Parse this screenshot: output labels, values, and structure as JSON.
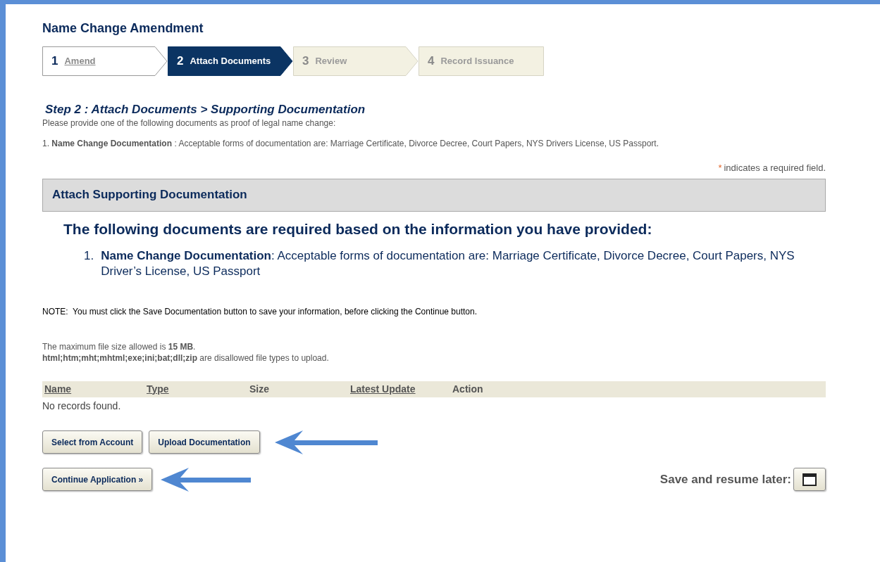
{
  "page_title": "Name Change Amendment",
  "steps": [
    {
      "number": "1",
      "label": "Amend",
      "selected": false,
      "completed": true
    },
    {
      "number": "2",
      "label": "Attach Documents",
      "selected": true,
      "completed": false
    },
    {
      "number": "3",
      "label": "Review",
      "selected": false,
      "completed": false
    },
    {
      "number": "4",
      "label": "Record Issuance",
      "selected": false,
      "completed": false
    }
  ],
  "step_heading": "Step 2 : Attach Documents > Supporting Documentation",
  "intro": "Please provide one of the following documents as proof of legal name change:",
  "intro_item": "1. **Name Change Documentation** : Acceptable forms of documentation are: Marriage Certificate, Divorce Decree, Court Papers, NYS Drivers License, US Passport.",
  "required_mark": "*",
  "required_note": "indicates a required field.",
  "section_title": "Attach Supporting Documentation",
  "required_heading": "The following documents are required based on the information you have provided:",
  "required_docs": [
    {
      "number": "1.",
      "text": "**Name Change Documentation**: Acceptable forms of documentation are: Marriage Certificate, Divorce Decree, Court Papers, NYS Driver’s License, US Passport"
    }
  ],
  "note": "NOTE:  You must click the Save Documentation button to save your information, before clicking the Continue button.",
  "max_size": "The maximum file size allowed is **15 MB**.",
  "disallowed": "**html;htm;mht;mhtml;exe;ini;bat;dll;zip** are disallowed file types to upload.",
  "table": {
    "columns": [
      {
        "label": "Name",
        "sortable": true
      },
      {
        "label": "Type",
        "sortable": true
      },
      {
        "label": "Size",
        "sortable": false
      },
      {
        "label": "Latest Update",
        "sortable": true
      },
      {
        "label": "Action",
        "sortable": false
      }
    ],
    "empty_text": "No records found."
  },
  "buttons": [
    "Select from Account",
    "Upload Documentation"
  ],
  "continue_button": "Continue Application »",
  "save_label": "Save and resume later:"
}
